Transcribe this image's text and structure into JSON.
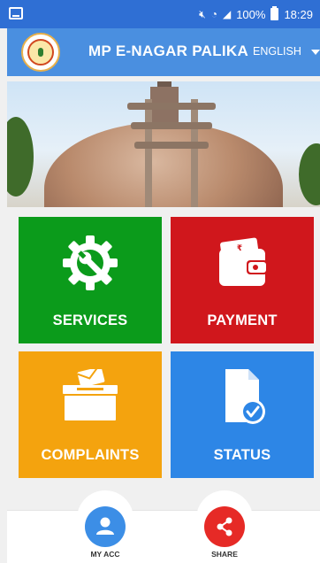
{
  "status_bar": {
    "battery": "100%",
    "time": "18:29",
    "icons": [
      "notification-icon",
      "mute-icon",
      "wifi-icon",
      "signal-icon",
      "battery-icon"
    ]
  },
  "toolbar": {
    "title": "MP E-NAGAR PALIKA",
    "language": "ENGLISH",
    "logo_icon": "municipal-emblem-icon",
    "colors": {
      "status_bar": "#2f6fd4",
      "toolbar": "#4a8fe0"
    }
  },
  "banner": {
    "image": "sanchi-stupa-photo"
  },
  "tiles": [
    {
      "label": "SERVICES",
      "icon": "gear-wrench-icon",
      "color": "#0b9b1b"
    },
    {
      "label": "PAYMENT",
      "icon": "wallet-rupee-icon",
      "color": "#d0171c"
    },
    {
      "label": "COMPLAINTS",
      "icon": "ballot-box-icon",
      "color": "#f4a30e"
    },
    {
      "label": "STATUS",
      "icon": "document-check-icon",
      "color": "#2d86e6"
    }
  ],
  "bottom_nav": {
    "my_acc": {
      "label": "MY ACC",
      "icon": "user-icon",
      "color": "#3c8ee6"
    },
    "share": {
      "label": "SHARE",
      "icon": "share-icon",
      "color": "#e62a26"
    }
  }
}
